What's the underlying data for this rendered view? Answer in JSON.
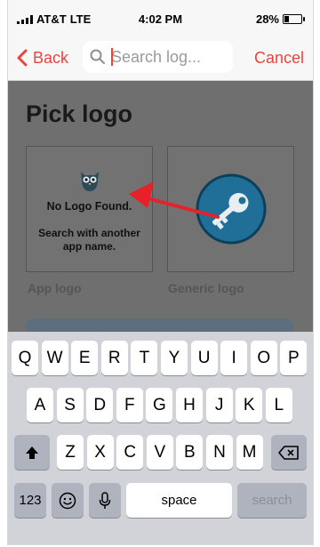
{
  "status_bar": {
    "carrier": "AT&T",
    "network": "LTE",
    "time": "4:02 PM",
    "battery": "28%",
    "battery_level": 0.28
  },
  "nav": {
    "back_label": "Back",
    "search_placeholder": "Search log...",
    "cancel_label": "Cancel"
  },
  "page": {
    "title": "Pick logo",
    "cards": [
      {
        "label": "App logo",
        "message": "No Logo Found.",
        "hint": "Search with another app name."
      },
      {
        "label": "Generic logo"
      }
    ]
  },
  "keyboard": {
    "row1": [
      "Q",
      "W",
      "E",
      "R",
      "T",
      "Y",
      "U",
      "I",
      "O",
      "P"
    ],
    "row2": [
      "A",
      "S",
      "D",
      "F",
      "G",
      "H",
      "J",
      "K",
      "L"
    ],
    "row3": [
      "Z",
      "X",
      "C",
      "V",
      "B",
      "N",
      "M"
    ],
    "bottom": {
      "numbers": "123",
      "space": "space",
      "action": "search"
    }
  },
  "colors": {
    "accent": "#e8453c",
    "overlay": "#6f6f6f",
    "key_logo": "#1f6f98",
    "arrow": "#e8202a"
  }
}
